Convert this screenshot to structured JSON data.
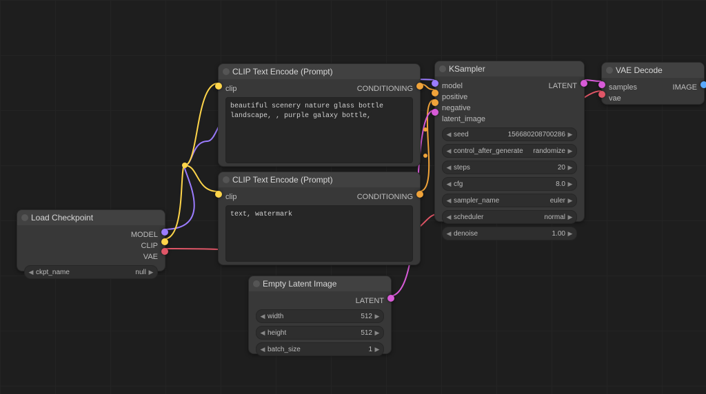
{
  "colors": {
    "model": "#9b7cff",
    "clip": "#ffd54a",
    "vae": "#e05667",
    "conditioning": "#f0a33a",
    "latent": "#d85bd8",
    "image": "#5aaaff",
    "neutral": "#8a8a8a"
  },
  "nodes": {
    "load_checkpoint": {
      "title": "Load Checkpoint",
      "outputs": {
        "model": "MODEL",
        "clip": "CLIP",
        "vae": "VAE"
      },
      "widgets": {
        "ckpt_name": {
          "label": "ckpt_name",
          "value": "null"
        }
      }
    },
    "clip_pos": {
      "title": "CLIP Text Encode (Prompt)",
      "inputs": {
        "clip": "clip"
      },
      "outputs": {
        "conditioning": "CONDITIONING"
      },
      "text": "beautiful scenery nature glass bottle landscape, , purple galaxy bottle,"
    },
    "clip_neg": {
      "title": "CLIP Text Encode (Prompt)",
      "inputs": {
        "clip": "clip"
      },
      "outputs": {
        "conditioning": "CONDITIONING"
      },
      "text": "text, watermark"
    },
    "empty_latent": {
      "title": "Empty Latent Image",
      "outputs": {
        "latent": "LATENT"
      },
      "widgets": {
        "width": {
          "label": "width",
          "value": "512"
        },
        "height": {
          "label": "height",
          "value": "512"
        },
        "batch_size": {
          "label": "batch_size",
          "value": "1"
        }
      }
    },
    "ksampler": {
      "title": "KSampler",
      "inputs": {
        "model": "model",
        "positive": "positive",
        "negative": "negative",
        "latent_image": "latent_image"
      },
      "outputs": {
        "latent": "LATENT"
      },
      "widgets": {
        "seed": {
          "label": "seed",
          "value": "156680208700286"
        },
        "control_after_generate": {
          "label": "control_after_generate",
          "value": "randomize"
        },
        "steps": {
          "label": "steps",
          "value": "20"
        },
        "cfg": {
          "label": "cfg",
          "value": "8.0"
        },
        "sampler_name": {
          "label": "sampler_name",
          "value": "euler"
        },
        "scheduler": {
          "label": "scheduler",
          "value": "normal"
        },
        "denoise": {
          "label": "denoise",
          "value": "1.00"
        }
      }
    },
    "vae_decode": {
      "title": "VAE Decode",
      "inputs": {
        "samples": "samples",
        "vae": "vae"
      },
      "outputs": {
        "image": "IMAGE"
      }
    }
  }
}
